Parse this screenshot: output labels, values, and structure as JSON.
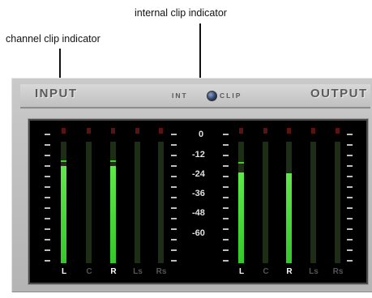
{
  "callouts": {
    "internal_clip": "internal clip indicator",
    "channel_clip": "channel clip indicator"
  },
  "header": {
    "input_label": "INPUT",
    "output_label": "OUTPUT",
    "int_label": "INT",
    "clip_label": "CLIP"
  },
  "scale_labels": [
    "0",
    "-12",
    "-24",
    "-36",
    "-48",
    "-60"
  ],
  "input_channels": [
    {
      "label": "L",
      "level": 0.8,
      "peak": 0.82,
      "active": true
    },
    {
      "label": "C",
      "level": 0,
      "peak": 0,
      "active": false
    },
    {
      "label": "R",
      "level": 0.8,
      "peak": 0.82,
      "active": true
    },
    {
      "label": "Ls",
      "level": 0,
      "peak": 0,
      "active": false
    },
    {
      "label": "Rs",
      "level": 0,
      "peak": 0,
      "active": false
    }
  ],
  "output_channels": [
    {
      "label": "L",
      "level": 0.75,
      "peak": 0.81,
      "active": true
    },
    {
      "label": "C",
      "level": 0,
      "peak": 0,
      "active": false
    },
    {
      "label": "R",
      "level": 0.74,
      "peak": 0,
      "active": true
    },
    {
      "label": "Ls",
      "level": 0,
      "peak": 0,
      "active": false
    },
    {
      "label": "Rs",
      "level": 0,
      "peak": 0,
      "active": false
    }
  ],
  "colors": {
    "meter_green": "#3ed030",
    "clip_off": "#5a1212",
    "clip_indicator_blue": "#2a3a60"
  }
}
